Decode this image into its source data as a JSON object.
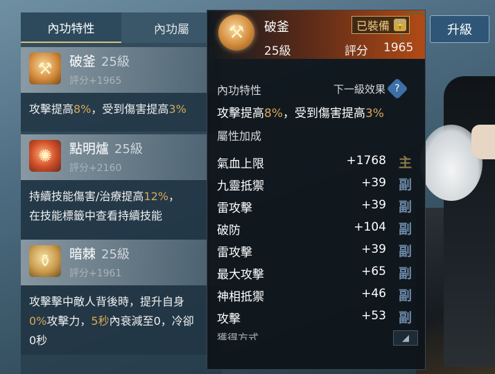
{
  "tabs": [
    {
      "label": "內功特性"
    },
    {
      "label": "內功屬"
    }
  ],
  "cards": [
    {
      "name": "破釜",
      "level": "25級",
      "score": "評分+1965",
      "desc_parts": [
        "攻擊提高",
        "8%",
        "，受到傷害提高",
        "3%"
      ],
      "icon": "axe-icon"
    },
    {
      "name": "點明爐",
      "level": "25級",
      "score": "評分+2160",
      "desc_parts": [
        "持續技能傷害/治療提高",
        "12%",
        "，",
        "在技能標籤中查看持續技能"
      ],
      "icon": "flame-orb-icon"
    },
    {
      "name": "暗棘",
      "level": "25級",
      "score": "評分+1961",
      "desc_parts": [
        "攻擊擊中敵人背後時，提升自身",
        "0%",
        "攻擊力，",
        "5秒",
        "內衰減至0，冷卻",
        "0秒"
      ],
      "icon": "pot-icon"
    }
  ],
  "upgrade_label": "升級",
  "popup": {
    "name": "破釜",
    "equipped_label": "已裝備",
    "level": "25級",
    "score_label": "評分",
    "score": "1965",
    "trait_title": "內功特性",
    "next_effect_label": "下一級效果",
    "effect_parts": [
      "攻擊提高",
      "8%",
      "，受到傷害提高",
      "3%"
    ],
    "attr_title": "屬性加成",
    "stats": [
      {
        "name": "氣血上限",
        "value": "+1768",
        "tag": "主",
        "kind": "main"
      },
      {
        "name": "九靈抵禦",
        "value": "+39",
        "tag": "副",
        "kind": "sub"
      },
      {
        "name": "雷攻擊",
        "value": "+39",
        "tag": "副",
        "kind": "sub"
      },
      {
        "name": "破防",
        "value": "+104",
        "tag": "副",
        "kind": "sub"
      },
      {
        "name": "雷攻擊",
        "value": "+39",
        "tag": "副",
        "kind": "sub"
      },
      {
        "name": "最大攻擊",
        "value": "+65",
        "tag": "副",
        "kind": "sub"
      },
      {
        "name": "神相抵禦",
        "value": "+46",
        "tag": "副",
        "kind": "sub"
      },
      {
        "name": "攻擊",
        "value": "+53",
        "tag": "副",
        "kind": "sub"
      }
    ],
    "source_title": "獲得方式"
  },
  "colors": {
    "highlight": "#d8a85a",
    "accent_orange": "#b24b16",
    "sub_tag": "#6d8aa8"
  }
}
